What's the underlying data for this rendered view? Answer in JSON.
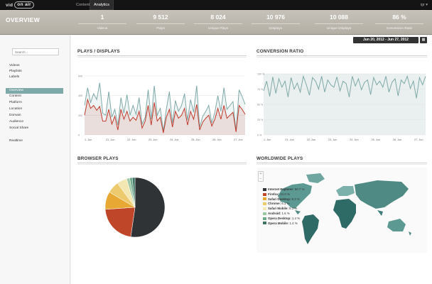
{
  "topbar": {
    "logo_prefix": "vid",
    "logo_box": "on air",
    "tabs": [
      "Content",
      "Analytics"
    ],
    "user": "igr ▾"
  },
  "page_title": "OVERVIEW",
  "stats": [
    {
      "value": "1",
      "label": "Videos"
    },
    {
      "value": "9 512",
      "label": "Plays"
    },
    {
      "value": "8 024",
      "label": "Unique Plays"
    },
    {
      "value": "10 976",
      "label": "Displays"
    },
    {
      "value": "10 088",
      "label": "Unique Displays"
    },
    {
      "value": "86 %",
      "label": "Conversion Ratio"
    }
  ],
  "date_range": "Jun 20, 2012 - Jun 27, 2012",
  "sidebar": {
    "search_placeholder": "Search...",
    "items": [
      "Videos",
      "Playlists",
      "Labels",
      "Overview",
      "Content",
      "Platform",
      "Location",
      "Domain",
      "Audience",
      "Social Share",
      "Realtime"
    ],
    "active": "Overview"
  },
  "panels": {
    "plays_displays": "PLAYS / DISPLAYS",
    "conversion": "CONVERSION RATIO",
    "browser": "BROWSER PLAYS",
    "world": "WORLDWIDE PLAYS"
  },
  "colors": {
    "teal": "#7fa9a8",
    "red": "#c0392b",
    "topbar": "#141414",
    "stats_bg": "#bcb8ae"
  },
  "chart_data": [
    {
      "type": "line",
      "title": "PLAYS / DISPLAYS",
      "x_ticks": [
        "1. Jun",
        "21. Jun",
        "22. Jun",
        "23. Jun",
        "24. Jun",
        "25. Jun",
        "26. Jun",
        "27. Jun"
      ],
      "y_ticks": [
        "0",
        "200",
        "400",
        "600"
      ],
      "ylim": [
        0,
        600
      ],
      "series": [
        {
          "color": "#7fa9a8",
          "values": [
            300,
            480,
            330,
            420,
            360,
            530,
            220,
            200,
            440,
            180,
            260,
            100,
            380,
            220,
            410,
            200,
            300,
            210,
            380,
            110,
            180,
            460,
            160,
            500,
            200,
            270,
            40,
            260,
            440,
            120,
            350,
            240,
            300,
            420,
            150,
            360,
            230,
            500,
            80,
            190,
            240,
            300,
            120,
            230,
            400,
            240,
            480,
            260,
            300,
            340,
            40,
            460,
            390,
            310
          ]
        },
        {
          "color": "#c0392b",
          "values": [
            200,
            360,
            270,
            300,
            250,
            290,
            140,
            140,
            260,
            110,
            190,
            50,
            260,
            160,
            240,
            140,
            180,
            150,
            240,
            70,
            140,
            300,
            100,
            330,
            140,
            180,
            20,
            180,
            260,
            80,
            240,
            170,
            200,
            270,
            100,
            240,
            160,
            310,
            50,
            130,
            170,
            200,
            90,
            160,
            270,
            160,
            300,
            170,
            200,
            230,
            30,
            300,
            260,
            210
          ]
        }
      ],
      "grid": true
    },
    {
      "type": "line",
      "title": "CONVERSION RATIO",
      "x_ticks": [
        "1. Jun",
        "21. Jun",
        "22. Jun",
        "23. Jun",
        "24. Jun",
        "25. Jun",
        "26. Jun",
        "27. Jun"
      ],
      "y_ticks": [
        "0 %",
        "25 %",
        "50 %",
        "75 %",
        "100 %"
      ],
      "ylim": [
        0,
        100
      ],
      "series": [
        {
          "color": "#7fa9a8",
          "values": [
            72,
            88,
            63,
            95,
            68,
            92,
            78,
            88,
            62,
            94,
            75,
            85,
            70,
            96,
            82,
            65,
            94,
            88,
            75,
            96,
            70,
            90,
            82,
            78,
            95,
            72,
            88,
            84,
            62,
            96,
            80,
            92,
            74,
            86,
            90,
            66,
            94,
            82,
            88,
            78,
            96,
            70,
            86,
            92,
            64,
            90,
            84,
            96,
            76,
            88,
            60,
            94,
            82,
            96
          ]
        }
      ],
      "grid": true
    },
    {
      "type": "pie",
      "title": "BROWSER PLAYS",
      "categories": [
        "Internet Explorer",
        "Firefox",
        "Safari Desktop",
        "Chrome",
        "Safari Mobile",
        "Android",
        "Opera Desktop",
        "Opera Mobile"
      ],
      "values": [
        50.7,
        21.0,
        9.3,
        6.3,
        5.3,
        1.6,
        1.4,
        1.4
      ],
      "labels": [
        "50.7 %",
        "21.0 %",
        "9.3 %",
        "6.3 %",
        "5.3 %",
        "1.6 %",
        "1.4 %",
        "1.4 %"
      ],
      "colors": [
        "#303336",
        "#c0462a",
        "#e7a933",
        "#ecca6d",
        "#f3e7b3",
        "#9ec7a4",
        "#6da98a",
        "#3f7564"
      ],
      "legend": "right"
    }
  ]
}
